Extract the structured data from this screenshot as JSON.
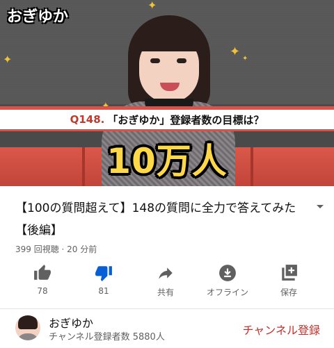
{
  "video": {
    "logo": "おぎゆか",
    "question_number": "Q148.",
    "question_text": "「おぎゆか」登録者数の目標は？",
    "big_caption": "10万人"
  },
  "metadata": {
    "title": "【100の質問超えて】148の質問に全力で答えてみた【後編】",
    "meta": "399 回視聴 · 20 分前"
  },
  "actions": {
    "like_count": "78",
    "dislike_count": "81",
    "share_label": "共有",
    "offline_label": "オフライン",
    "save_label": "保存"
  },
  "channel": {
    "name": "おぎゆか",
    "subscribers": "チャンネル登録者数 5880人",
    "subscribe_label": "チャンネル登録"
  },
  "colors": {
    "accent_red": "#c4302b",
    "dislike_active": "#065fd4",
    "caption_gold": "#ffd84a"
  }
}
